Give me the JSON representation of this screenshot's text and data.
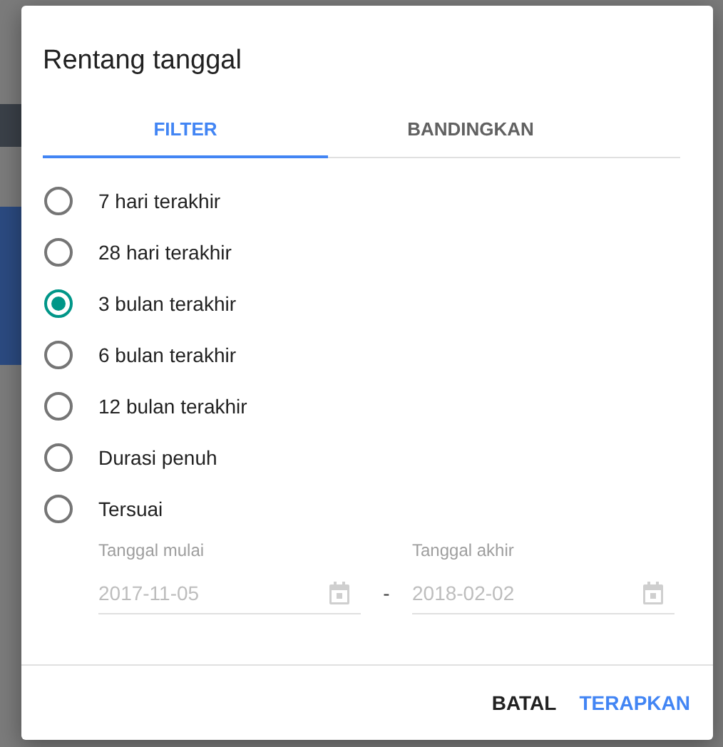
{
  "dialog": {
    "title": "Rentang tanggal"
  },
  "tabs": [
    {
      "label": "FILTER",
      "selected": true
    },
    {
      "label": "BANDINGKAN",
      "selected": false
    }
  ],
  "options": [
    {
      "label": "7 hari terakhir",
      "selected": false
    },
    {
      "label": "28 hari terakhir",
      "selected": false
    },
    {
      "label": "3 bulan terakhir",
      "selected": true
    },
    {
      "label": "6 bulan terakhir",
      "selected": false
    },
    {
      "label": "12 bulan terakhir",
      "selected": false
    },
    {
      "label": "Durasi penuh",
      "selected": false
    },
    {
      "label": "Tersuai",
      "selected": false
    }
  ],
  "date_range": {
    "separator": "-",
    "fields": [
      {
        "label": "Tanggal mulai",
        "value": "2017-11-05",
        "disabled": true
      },
      {
        "label": "Tanggal akhir",
        "value": "2018-02-02",
        "disabled": true
      }
    ]
  },
  "buttons": [
    {
      "label": "BATAL",
      "kind": "secondary"
    },
    {
      "label": "TERAPKAN",
      "kind": "primary"
    }
  ]
}
